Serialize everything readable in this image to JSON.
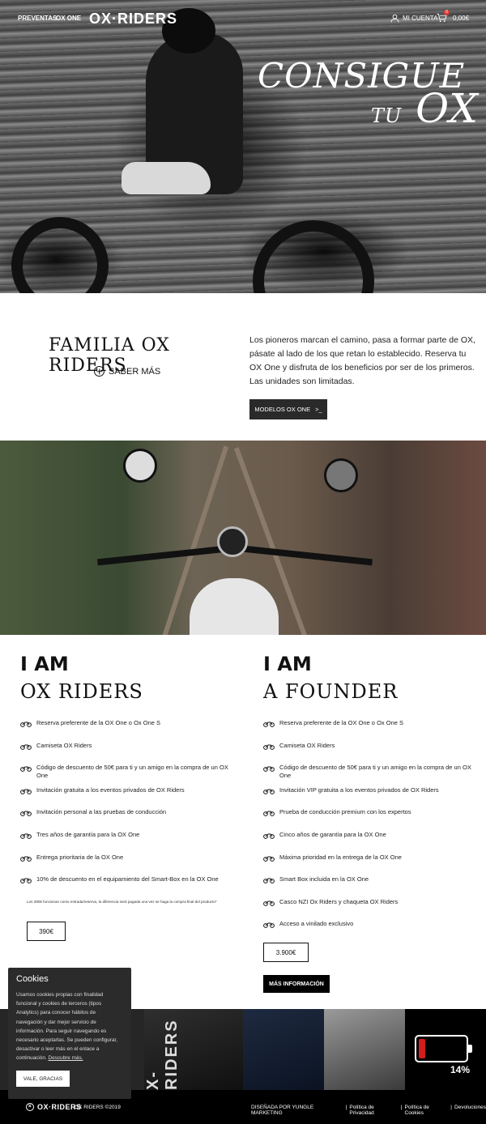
{
  "nav": {
    "preventas": "PREVENTAS",
    "ox_one": "OX ONE",
    "logo": "OX·RIDERS",
    "account": "MI CUENTA",
    "cart_total": "0,00€",
    "cart_count": "0"
  },
  "hero": {
    "line1": "CONSIGUE",
    "line2_small": "TU",
    "line2_big": "OX"
  },
  "familia": {
    "title": "FAMILIA OX RIDERS",
    "saber": "SABER MÁS",
    "text": "Los pioneros marcan el camino, pasa a formar parte de OX, pásate al lado de los que retan lo establecido. Reserva tu OX One y disfruta de los beneficios por ser de los primeros. Las unidades son limitadas.",
    "button": "MODELOS OX ONE",
    "button_arrow": ">_"
  },
  "riders": {
    "iam": "I AM",
    "sub": "OX RIDERS",
    "items": [
      "Reserva preferente de la OX One o Ox One S",
      "Camiseta OX Riders",
      "Código de descuento de 50€ para ti y un amigo en la compra de un OX One",
      "Invitación gratuita a los eventos privados de OX Riders",
      "Invitación personal a las pruebas de conducción",
      "Tres años de garantía para la OX One",
      "Entrega prioritaria de la OX One",
      "10% de descuento en el equipamiento del Smart-Box en la OX One"
    ],
    "note": "Los 390€ funcionan como entrada/reserva, la diferencia será pagada una vez se haga la compra final del producto*",
    "price": "390€"
  },
  "founder": {
    "iam": "I AM",
    "sub": "A FOUNDER",
    "items": [
      "Reserva preferente de la OX One o Ox One S",
      "Camiseta OX Riders",
      "Código de descuento de 50€ para ti y un amigo en la compra de un OX One",
      "Invitación VIP gratuita a los eventos privados de OX Riders",
      "Prueba de conducción premium con los expertos",
      "Cinco años de garantía para la OX One",
      "Máxima prioridad en la entrega de la OX One",
      "Smart Box incluida en la OX One",
      "Casco NZI Ox Riders y chaqueta OX Riders",
      "Acceso a vinilado exclusivo"
    ],
    "price": "3.900€",
    "more": "MÁS INFORMACIÓN"
  },
  "gallery": {
    "brand_vertical": "X-RIDERS",
    "battery_pct": "14%",
    "battery_level": 0.14,
    "battery_color": "#d21d1d"
  },
  "footer": {
    "logo": "OX·RIDERS",
    "copyright": "OX RIDERS ©2019",
    "designed": "DISEÑADA POR YUNGLE MARKETING",
    "privacy": "Política de Privacidad",
    "cookies": "Política de Cookies",
    "returns": "Devoluciones",
    "sep": "|"
  },
  "cookies": {
    "title": "Cookies",
    "text": "Usamos cookies propias con finalidad funcional y cookies de terceros (tipos Analytics) para conocer hábitos de navegación y dar mejor servicio de información. Para seguir navegando es necesario aceptarlas. Se pueden configurar, desactivar o leer más en el enlace a continuación.",
    "link": "Descubre más.",
    "button": "VALE, GRACIAS"
  }
}
